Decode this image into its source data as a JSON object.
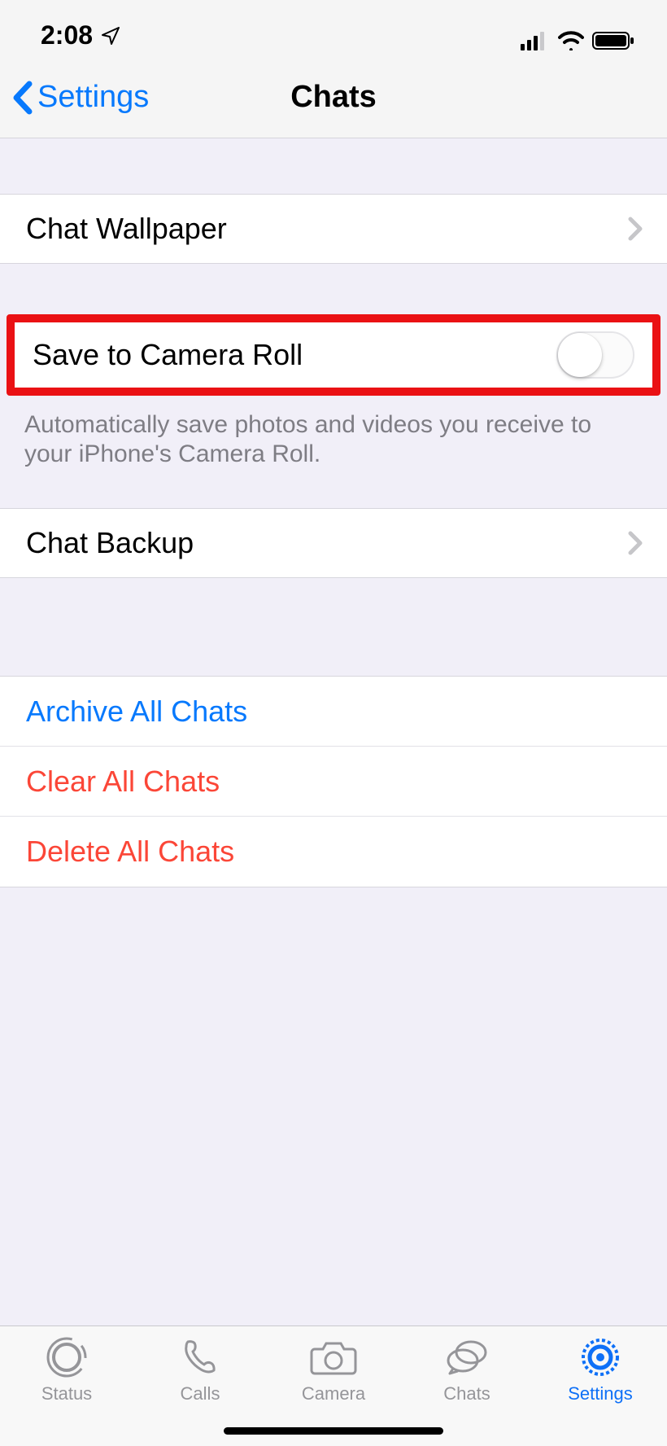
{
  "status_bar": {
    "time": "2:08"
  },
  "nav": {
    "back_label": "Settings",
    "title": "Chats"
  },
  "rows": {
    "wallpaper": "Chat Wallpaper",
    "save_camera_roll": "Save to Camera Roll",
    "save_camera_roll_on": false,
    "save_camera_roll_note": "Automatically save photos and videos you receive to your iPhone's Camera Roll.",
    "chat_backup": "Chat Backup",
    "archive_all": "Archive All Chats",
    "clear_all": "Clear All Chats",
    "delete_all": "Delete All Chats"
  },
  "tabs": {
    "status": "Status",
    "calls": "Calls",
    "camera": "Camera",
    "chats": "Chats",
    "settings": "Settings",
    "active": "settings"
  }
}
